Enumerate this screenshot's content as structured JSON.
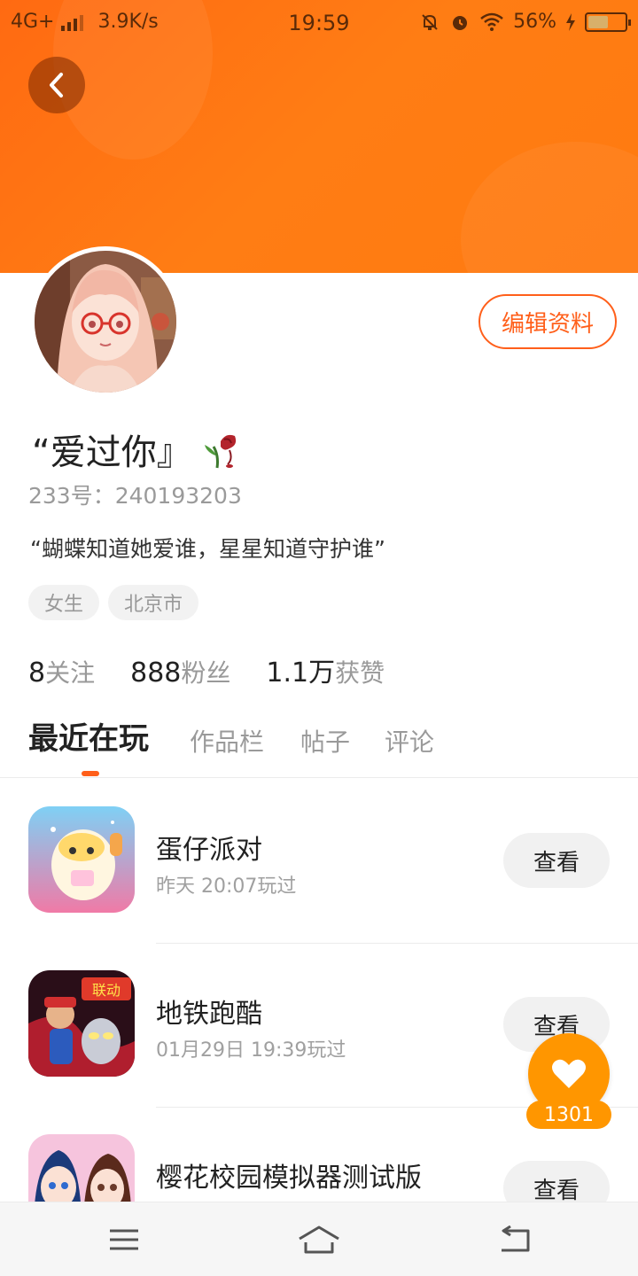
{
  "status_bar": {
    "network": "4G+",
    "speed": "3.9K/s",
    "time": "19:59",
    "battery": "56%",
    "battery_level": 0.56
  },
  "profile": {
    "name": "“爱过你』",
    "id_text": "233号：240193203",
    "bio": "“蝴蝶知道她爱谁，星星知道守护谁”",
    "tags": [
      "女生",
      "北京市"
    ],
    "edit_label": "编辑资料"
  },
  "stats": [
    {
      "num": "8",
      "label": "关注"
    },
    {
      "num": "888",
      "label": "粉丝"
    },
    {
      "num": "1.1万",
      "label": "获赞"
    }
  ],
  "tabs": [
    "最近在玩",
    "作品栏",
    "帖子",
    "评论"
  ],
  "games": [
    {
      "title": "蛋仔派对",
      "sub": "昨天 20:07玩过",
      "action": "查看"
    },
    {
      "title": "地铁跑酷",
      "sub": "01月29日 19:39玩过",
      "action": "查看"
    },
    {
      "title": "樱花校园模拟器测试版",
      "sub": "",
      "action": "查看"
    }
  ],
  "like": {
    "count": "1301"
  },
  "colors": {
    "accent": "#ff5f1a",
    "banner": "#ff7a10",
    "like": "#ff9600"
  }
}
